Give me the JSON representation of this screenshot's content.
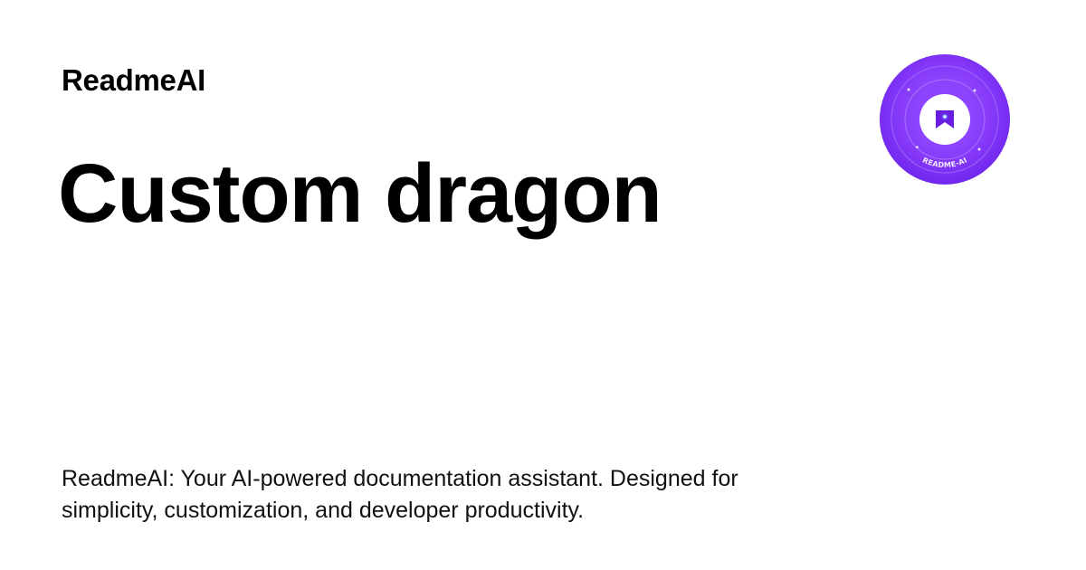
{
  "header": {
    "brand": "ReadmeAI"
  },
  "main": {
    "title": "Custom dragon",
    "description": "ReadmeAI: Your AI-powered documentation assistant. Designed for simplicity, customization, and developer productivity."
  },
  "logo": {
    "icon": "readme-ai-badge-icon",
    "text": "README-AI",
    "colors": {
      "outer": "#7b2ff7",
      "inner": "#9b4dff",
      "center": "#ffffff",
      "mark": "#6a1fe0"
    }
  },
  "colors": {
    "background": "#ffffff",
    "text": "#000000"
  }
}
